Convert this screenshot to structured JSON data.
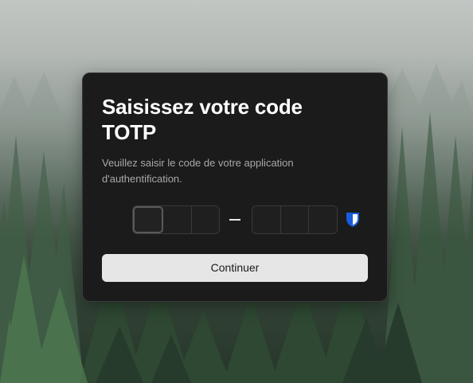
{
  "dialog": {
    "title": "Saisissez votre code TOTP",
    "description": "Veuillez saisir le code de votre application d'authentification.",
    "code_groups": [
      {
        "cells": [
          "",
          "",
          ""
        ]
      },
      {
        "cells": [
          "",
          "",
          ""
        ]
      }
    ],
    "separator": "–",
    "password_manager_icon": "shield-icon",
    "continue_label": "Continuer"
  },
  "colors": {
    "dialog_background": "#1b1b1b",
    "button_background": "#e6e6e6",
    "shield_icon": "#175ddc"
  }
}
